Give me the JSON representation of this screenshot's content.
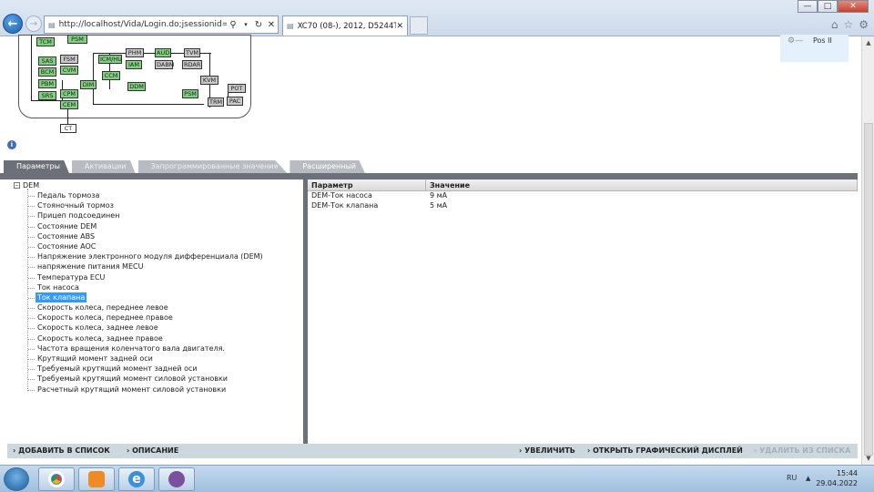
{
  "browser": {
    "address": "http://localhost/Vida/Login.do;jsessionid=2WE9iZE",
    "tab_title": "XC70 (08-), 2012, D5244T17,...",
    "search_icon": "search-icon",
    "refresh_icon": "refresh-icon",
    "stop_icon": "stop-icon"
  },
  "diagram": {
    "nodes": [
      "TCM",
      "PSM",
      "SAS",
      "FSM",
      "BCM",
      "CVM",
      "PBM",
      "SRS",
      "CPM",
      "CEM",
      "CT",
      "DIM",
      "ICM/HU",
      "PHM",
      "IAM",
      "AUD",
      "DABM",
      "TVM",
      "RDAR",
      "CCM",
      "DDM",
      "KVM",
      "POT",
      "PSM",
      "TRM",
      "PAC"
    ]
  },
  "position": {
    "label": "Pos II"
  },
  "tabs": [
    {
      "label": "Параметры",
      "active": true
    },
    {
      "label": "Активации",
      "active": false
    },
    {
      "label": "Запрограммированные значения",
      "active": false
    },
    {
      "label": "Расширенный",
      "active": false
    }
  ],
  "tree": {
    "root": "DEM",
    "items": [
      "Педаль тормоза",
      "Стояночный тормоз",
      "Прицеп подсоединен",
      "Состояние DEM",
      "Состояние ABS",
      "Состояние AOC",
      "Напряжение электронного модуля дифференциала (DEM)",
      "напряжение питания MECU",
      "Температура ECU",
      "Ток насоса",
      "Ток клапана",
      "Скорость колеса, переднее левое",
      "Скорость колеса, переднее правое",
      "Скорость колеса, заднее левое",
      "Скорость колеса, заднее правое",
      "Частота вращения коленчатого вала двигателя.",
      "Крутящий момент задней оси",
      "Требуемый крутящий момент задней оси",
      "Требуемый крутящий момент силовой установки",
      "Расчетный крутящий момент силовой установки"
    ],
    "selected_index": 10
  },
  "grid": {
    "headers": [
      "Параметр",
      "Значение"
    ],
    "rows": [
      [
        "DEM-Ток насоса",
        "9 мА"
      ],
      [
        "DEM-Ток клапана",
        "5 мА"
      ]
    ]
  },
  "actions": {
    "add_to_list": "ДОБАВИТЬ В СПИСОК",
    "description": "ОПИСАНИЕ",
    "zoom": "УВЕЛИЧИТЬ",
    "open_graph": "ОТКРЫТЬ ГРАФИЧЕСКИЙ ДИСПЛЕЙ",
    "remove_from_list": "УДАЛИТЬ ИЗ СПИСКА"
  },
  "taskbar": {
    "lang": "RU",
    "time": "15:44",
    "date": "29.04.2022"
  },
  "colors": {
    "node_green": "#7fd07f",
    "node_gray": "#c8c8c8",
    "tab_active": "#6b7079",
    "selection": "#3399ff"
  }
}
